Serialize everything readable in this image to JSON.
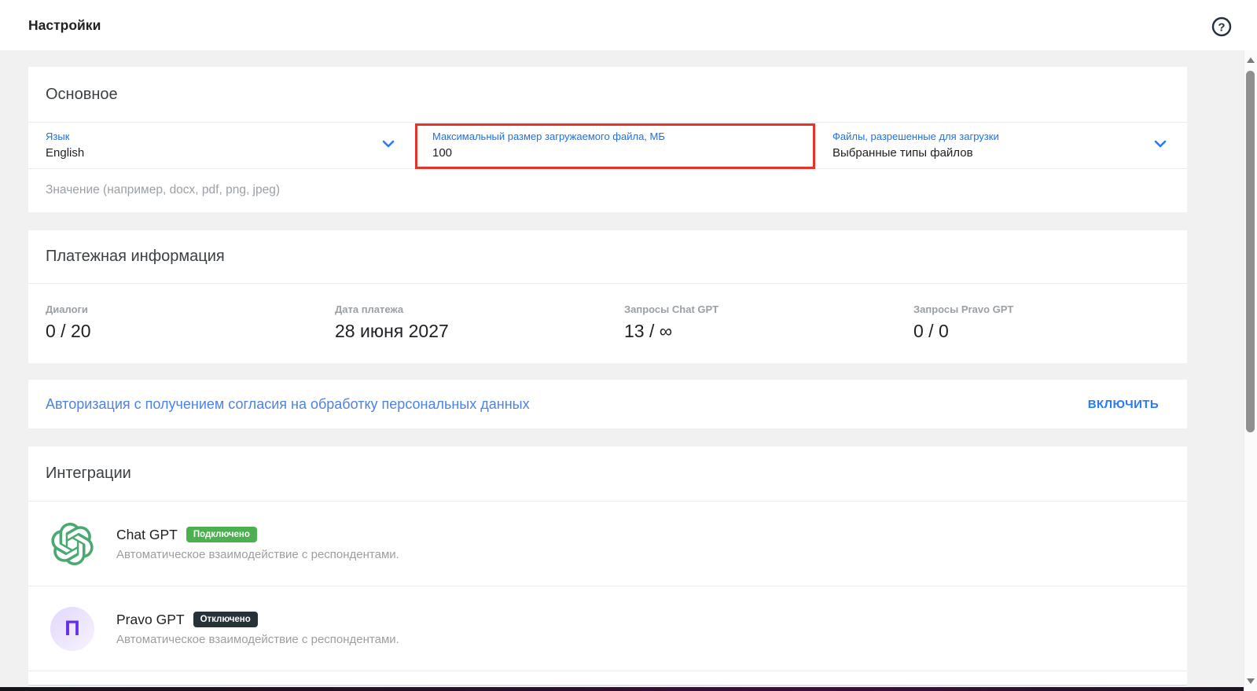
{
  "header": {
    "title": "Настройки"
  },
  "sections": {
    "general": {
      "title": "Основное",
      "fields": [
        {
          "label": "Язык",
          "value": "English",
          "has_chevron": true
        },
        {
          "label": "Максимальный размер загружаемого файла, МБ",
          "value": "100",
          "highlighted": true
        },
        {
          "label": "Файлы, разрешенные для загрузки",
          "value": "Выбранные типы файлов",
          "has_chevron": true
        }
      ],
      "hint": "Значение (например, docx, pdf, png, jpeg)"
    },
    "billing": {
      "title": "Платежная информация",
      "stats": [
        {
          "label": "Диалоги",
          "value": "0 / 20"
        },
        {
          "label": "Дата платежа",
          "value": "28 июня 2027"
        },
        {
          "label": "Запросы Chat GPT",
          "value": "13 / ∞"
        },
        {
          "label": "Запросы Pravo GPT",
          "value": "0 / 0"
        }
      ]
    },
    "authorization": {
      "text": "Авторизация с получением согласия на обработку персональных данных",
      "action_label": "ВКЛЮЧИТЬ"
    },
    "integrations": {
      "title": "Интеграции",
      "items": [
        {
          "name": "Chat GPT",
          "status": "Подключено",
          "status_color": "#4caf50",
          "description": "Автоматическое взаимодействие с респондентами.",
          "icon": "openai-logo"
        },
        {
          "name": "Pravo GPT",
          "status": "Отключено",
          "status_color": "#263238",
          "description": "Автоматическое взаимодействие с респондентами.",
          "icon": "pravo-logo",
          "letter": "П"
        }
      ]
    }
  },
  "colors": {
    "accent_blue": "#1a73e8",
    "link_blue": "#4d82e8",
    "button_blue": "#2979ff",
    "highlight_red": "#e5332a",
    "badge_green": "#4caf50",
    "badge_dark": "#263238",
    "openai_green": "#4aa871",
    "pravo_purple": "#6331e9",
    "help_icon_dark": "#22303f"
  }
}
